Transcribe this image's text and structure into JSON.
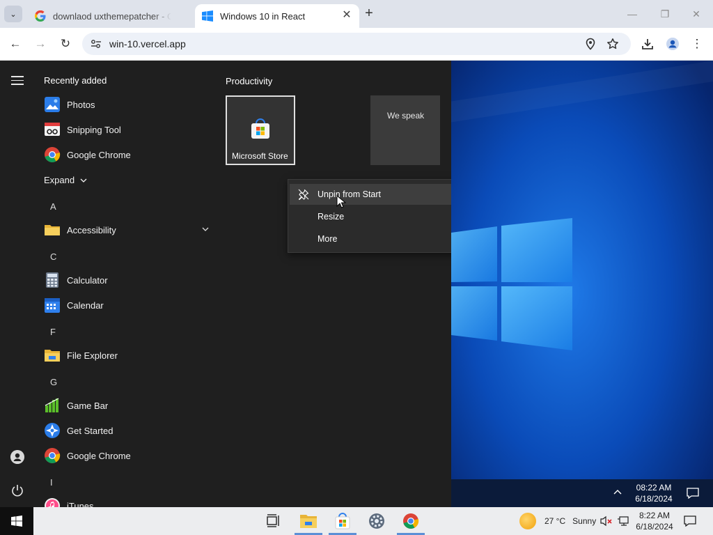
{
  "browser": {
    "tabs": [
      {
        "title": "downlaod uxthemepatcher - Goo",
        "favicon": "google-g-icon",
        "active": false
      },
      {
        "title": "Windows 10 in React",
        "favicon": "windows-logo-icon",
        "active": true
      }
    ],
    "url": "win-10.vercel.app",
    "tab_close_glyph": "✕",
    "new_tab_glyph": "+",
    "minimize_glyph": "—",
    "restore_glyph": "❐",
    "close_glyph": "✕",
    "back_glyph": "←",
    "forward_glyph": "→",
    "reload_glyph": "↻",
    "menu_glyph": "⋮",
    "tab_search_glyph": "⌄"
  },
  "start_menu": {
    "recently_added_title": "Recently added",
    "recent_apps": [
      {
        "name": "Photos",
        "icon": "photos-icon"
      },
      {
        "name": "Snipping Tool",
        "icon": "snipping-tool-icon"
      },
      {
        "name": "Google Chrome",
        "icon": "chrome-icon"
      }
    ],
    "expand_label": "Expand",
    "groups": [
      {
        "letter": "A",
        "apps": [
          {
            "name": "Accessibility",
            "icon": "folder-icon",
            "expandable": true
          }
        ]
      },
      {
        "letter": "C",
        "apps": [
          {
            "name": "Calculator",
            "icon": "calculator-icon"
          },
          {
            "name": "Calendar",
            "icon": "calendar-icon"
          }
        ]
      },
      {
        "letter": "F",
        "apps": [
          {
            "name": "File Explorer",
            "icon": "file-explorer-icon"
          }
        ]
      },
      {
        "letter": "G",
        "apps": [
          {
            "name": "Game Bar",
            "icon": "game-bar-icon"
          },
          {
            "name": "Get Started",
            "icon": "get-started-icon"
          },
          {
            "name": "Google Chrome",
            "icon": "chrome-icon"
          }
        ]
      },
      {
        "letter": "I",
        "apps": [
          {
            "name": "iTunes",
            "icon": "itunes-icon"
          }
        ]
      }
    ],
    "tiles_group_title": "Productivity",
    "tiles": [
      {
        "label": "Microsoft Store",
        "icon": "microsoft-store-icon"
      },
      {
        "label": "We speak",
        "icon": ""
      }
    ],
    "context_menu": [
      {
        "label": "Unpin from Start",
        "icon": "unpin-icon",
        "submenu": false
      },
      {
        "label": "Resize",
        "icon": "",
        "submenu": true
      },
      {
        "label": "More",
        "icon": "",
        "submenu": true
      }
    ]
  },
  "desktop": {
    "tray_time": "08:22 AM",
    "tray_date": "6/18/2024"
  },
  "taskbar": {
    "weather_temp": "27 °C",
    "weather_text": "Sunny",
    "time": "8:22 AM",
    "date": "6/18/2024"
  },
  "colors": {
    "start_bg": "#1f1f1f",
    "desktop_blue": "#0a3b94",
    "taskbar_bg": "#ecedef",
    "accent": "#5b8fd6"
  }
}
